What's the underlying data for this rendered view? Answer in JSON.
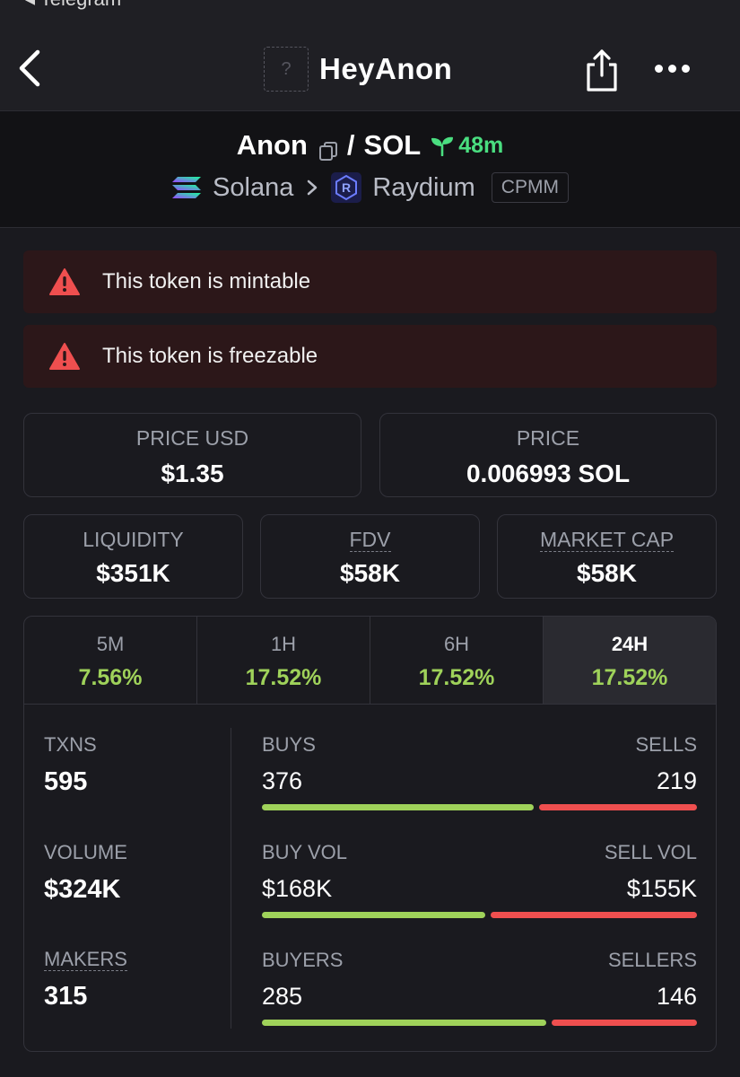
{
  "statusbar": {
    "back_app": "◂ Telegram"
  },
  "appbar": {
    "title": "HeyAnon",
    "avatar_glyph": "?"
  },
  "pair": {
    "base": "Anon",
    "separator": "/",
    "quote": "SOL",
    "age": "48m",
    "chain": "Solana",
    "dex": "Raydium",
    "pool_type": "CPMM"
  },
  "warnings": [
    {
      "text": "This token is mintable"
    },
    {
      "text": "This token is freezable"
    }
  ],
  "prices": {
    "usd_label": "PRICE USD",
    "usd_value": "$1.35",
    "native_label": "PRICE",
    "native_value": "0.006993 SOL"
  },
  "metrics": {
    "liquidity_label": "LIQUIDITY",
    "liquidity_value": "$351K",
    "fdv_label": "FDV",
    "fdv_value": "$58K",
    "mcap_label": "MARKET CAP",
    "mcap_value": "$58K"
  },
  "tabs": [
    {
      "label": "5M",
      "value": "7.56%"
    },
    {
      "label": "1H",
      "value": "17.52%"
    },
    {
      "label": "6H",
      "value": "17.52%"
    },
    {
      "label": "24H",
      "value": "17.52%",
      "active": true
    }
  ],
  "stats": {
    "txns_label": "TXNS",
    "txns_value": "595",
    "volume_label": "VOLUME",
    "volume_value": "$324K",
    "makers_label": "MAKERS",
    "makers_value": "315",
    "buys_label": "BUYS",
    "buys_value": "376",
    "sells_label": "SELLS",
    "sells_value": "219",
    "buyvol_label": "BUY VOL",
    "buyvol_value": "$168K",
    "sellvol_label": "SELL VOL",
    "sellvol_value": "$155K",
    "buyers_label": "BUYERS",
    "buyers_value": "285",
    "sellers_label": "SELLERS",
    "sellers_value": "146"
  },
  "ratios": {
    "txns_buy_share": 0.632,
    "volume_buy_share": 0.52,
    "makers_buy_share": 0.661
  },
  "colors": {
    "positive": "#9fd25a",
    "negative": "#ef4f4f",
    "age": "#4ade80",
    "warning_bg": "#2c1719",
    "warning_icon": "#ef4f4f"
  }
}
